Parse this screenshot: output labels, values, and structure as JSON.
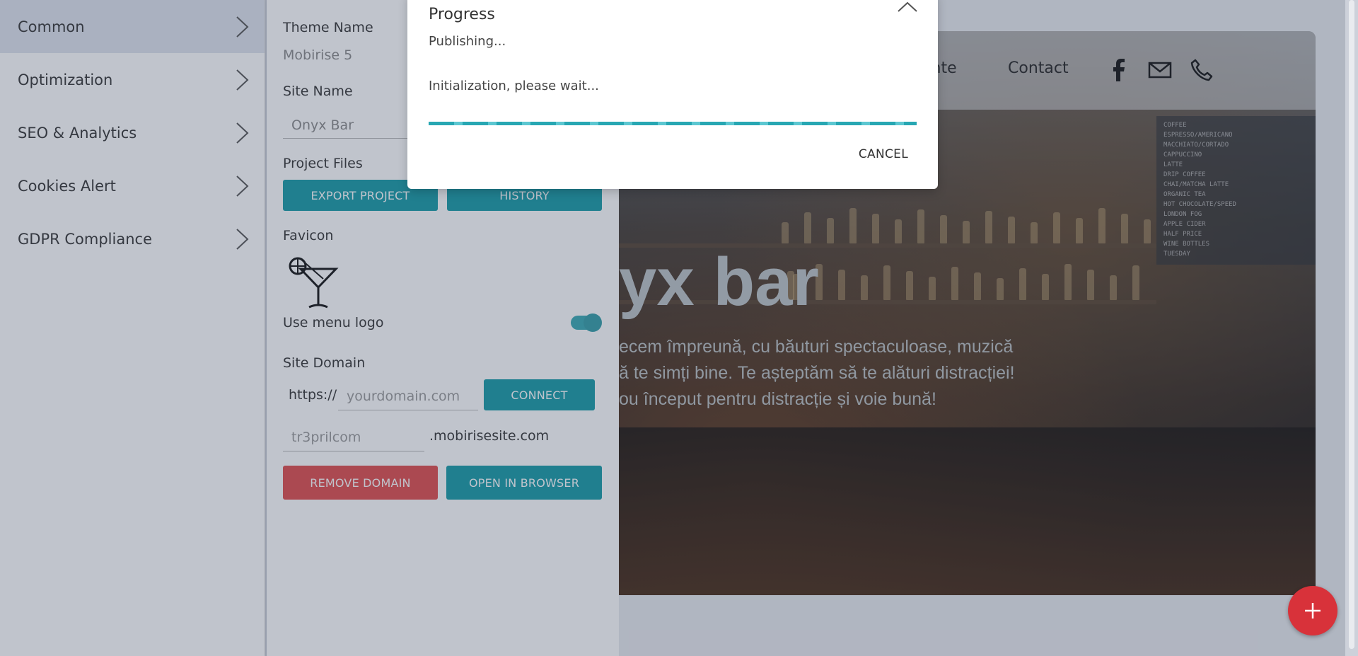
{
  "sidebar": {
    "items": [
      {
        "label": "Common"
      },
      {
        "label": "Optimization"
      },
      {
        "label": "SEO & Analytics"
      },
      {
        "label": "Cookies Alert"
      },
      {
        "label": "GDPR Compliance"
      }
    ]
  },
  "panel": {
    "theme_name_label": "Theme Name",
    "theme_name_value": "Mobirise 5",
    "site_name_label": "Site Name",
    "site_name_value": "Onyx Bar",
    "project_files_label": "Project Files",
    "export_label": "EXPORT PROJECT",
    "history_label": "HISTORY",
    "favicon_label": "Favicon",
    "use_menu_logo_label": "Use menu logo",
    "use_menu_logo_on": true,
    "site_domain_label": "Site Domain",
    "protocol": "https://",
    "domain_placeholder": "yourdomain.com",
    "connect_label": "CONNECT",
    "subdomain_placeholder": "tr3prilcom",
    "subdomain_suffix": ".mobirisesite.com",
    "remove_domain_label": "REMOVE DOMAIN",
    "open_browser_label": "OPEN IN BROWSER"
  },
  "preview": {
    "nav_partial": "ente",
    "nav_contact": "Contact",
    "board": {
      "lines": [
        "COFFEE",
        "ESPRESSO/AMERICANO",
        "MACCHIATO/CORTADO",
        "CAPPUCCINO",
        "LATTE",
        "DRIP COFFEE",
        "CHAI/MATCHA LATTE",
        "ORGANIC TEA",
        "HOT CHOCOLATE/SPEED",
        "LONDON FOG",
        "APPLE CIDER",
        "HALF PRICE",
        "WINE BOTTLES",
        "TUESDAY"
      ]
    },
    "hero_title_partial": "yx bar",
    "hero_lines": [
      "ecem împreună, cu băuturi spectaculoase, muzică",
      "ă te simți bine. Te așteptăm să te alături distracției!",
      "ou început pentru distracție și voie bună!"
    ]
  },
  "modal": {
    "title": "Progress",
    "status": "Publishing...",
    "message": "Initialization, please wait...",
    "progress": 1.0,
    "cancel_label": "CANCEL"
  },
  "colors": {
    "accent": "#149aa6",
    "danger": "#e04a4a",
    "fab": "#d8323a"
  },
  "icons": {
    "sidebar_chevron": "chevron-right-icon",
    "modal_close": "chevron-up-icon",
    "favicon": "cocktail-icon",
    "facebook": "facebook-icon",
    "mail": "mail-icon",
    "phone": "phone-icon",
    "fab": "plus-icon"
  }
}
